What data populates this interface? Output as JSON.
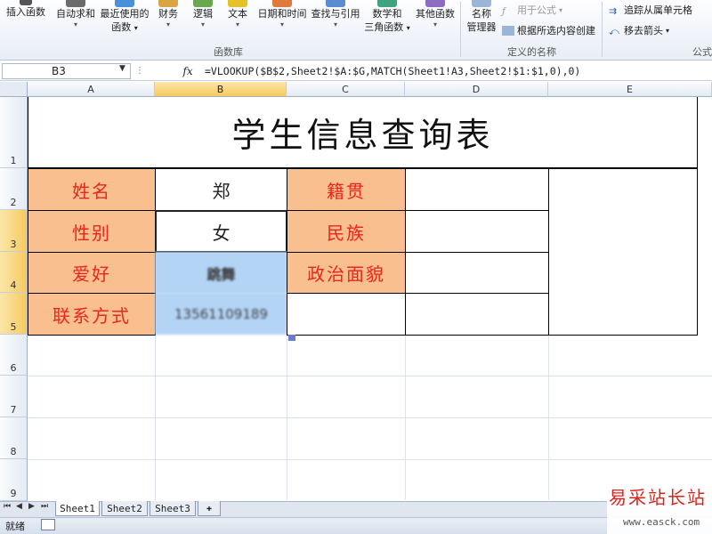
{
  "ribbon": {
    "insert_function": "插入函数",
    "autosum": "自动求和",
    "recent_line1": "最近使用的",
    "recent_line2": "函数",
    "financial": "财务",
    "logical": "逻辑",
    "text": "文本",
    "datetime": "日期和时间",
    "lookup": "查找与引用",
    "math_line1": "数学和",
    "math_line2": "三角函数",
    "more": "其他函数",
    "group_library": "函数库",
    "name_mgr_line1": "名称",
    "name_mgr_line2": "管理器",
    "use_in_formula": "用于公式",
    "create_from_selection": "根据所选内容创建",
    "group_names": "定义的名称",
    "trace_precedents": "追踪从属单元格",
    "remove_arrows": "移去箭头",
    "group_formula": "公式"
  },
  "formula_bar": {
    "name_box": "B3",
    "fx": "fx",
    "formula": "=VLOOKUP($B$2,Sheet2!$A:$G,MATCH(Sheet1!A3,Sheet2!$1:$1,0),0)"
  },
  "columns": [
    "A",
    "B",
    "C",
    "D",
    "E"
  ],
  "rows": [
    "1",
    "2",
    "3",
    "4",
    "5",
    "6",
    "7",
    "8",
    "9"
  ],
  "sheet": {
    "title": "学生信息查询表",
    "name_label": "姓名",
    "name_value": "郑",
    "native_label": "籍贯",
    "gender_label": "性别",
    "gender_value": "女",
    "ethnic_label": "民族",
    "hobby_label": "爱好",
    "hobby_value": "跳舞",
    "political_label": "政治面貌",
    "contact_label": "联系方式",
    "contact_value": "13561109189"
  },
  "tabs": [
    "Sheet1",
    "Sheet2",
    "Sheet3"
  ],
  "status": "就绪",
  "watermark": {
    "cn": "易采站长站",
    "url": "www.easck.com"
  },
  "colors": {
    "label_fill": "#f9bf8f",
    "label_text": "#e8261c",
    "selected_fill": "#b4d4f6"
  }
}
